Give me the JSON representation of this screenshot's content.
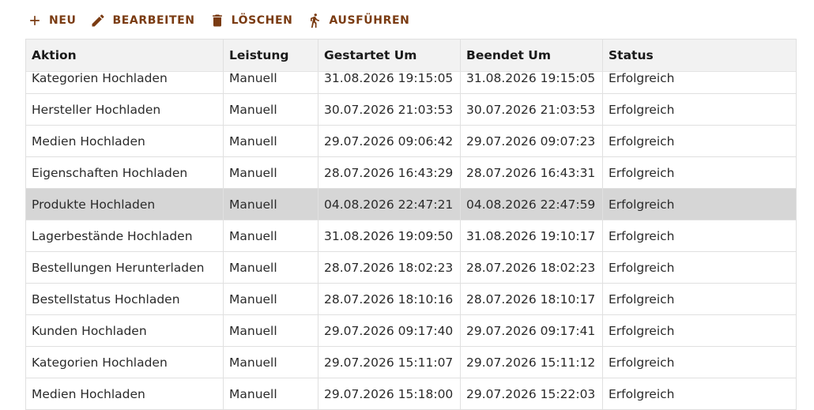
{
  "toolbar": {
    "new_label": "NEU",
    "edit_label": "BEARBEITEN",
    "delete_label": "LÖSCHEN",
    "run_label": "AUSFÜHREN",
    "accent_color": "#7a3b12"
  },
  "table": {
    "columns": [
      "Aktion",
      "Leistung",
      "Gestartet Um",
      "Beendet Um",
      "Status"
    ],
    "selected_row_index": 4,
    "rows": [
      [
        "Kategorien Hochladen",
        "Manuell",
        "31.08.2026 19:15:05",
        "31.08.2026 19:15:05",
        "Erfolgreich"
      ],
      [
        "Hersteller Hochladen",
        "Manuell",
        "30.07.2026 21:03:53",
        "30.07.2026 21:03:53",
        "Erfolgreich"
      ],
      [
        "Medien Hochladen",
        "Manuell",
        "29.07.2026 09:06:42",
        "29.07.2026 09:07:23",
        "Erfolgreich"
      ],
      [
        "Eigenschaften Hochladen",
        "Manuell",
        "28.07.2026 16:43:29",
        "28.07.2026 16:43:31",
        "Erfolgreich"
      ],
      [
        "Produkte Hochladen",
        "Manuell",
        "04.08.2026 22:47:21",
        "04.08.2026 22:47:59",
        "Erfolgreich"
      ],
      [
        "Lagerbestände Hochladen",
        "Manuell",
        "31.08.2026 19:09:50",
        "31.08.2026 19:10:17",
        "Erfolgreich"
      ],
      [
        "Bestellungen Herunterladen",
        "Manuell",
        "28.07.2026 18:02:23",
        "28.07.2026 18:02:23",
        "Erfolgreich"
      ],
      [
        "Bestellstatus Hochladen",
        "Manuell",
        "28.07.2026 18:10:16",
        "28.07.2026 18:10:17",
        "Erfolgreich"
      ],
      [
        "Kunden Hochladen",
        "Manuell",
        "29.07.2026 09:17:40",
        "29.07.2026 09:17:41",
        "Erfolgreich"
      ],
      [
        "Kategorien Hochladen",
        "Manuell",
        "29.07.2026 15:11:07",
        "29.07.2026 15:11:12",
        "Erfolgreich"
      ],
      [
        "Medien Hochladen",
        "Manuell",
        "29.07.2026 15:18:00",
        "29.07.2026 15:22:03",
        "Erfolgreich"
      ]
    ]
  }
}
